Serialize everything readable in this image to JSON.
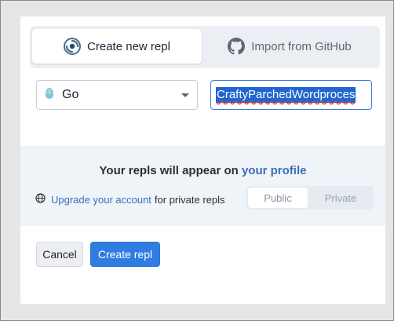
{
  "tabs": {
    "create_label": "Create new repl",
    "import_label": "Import from GitHub"
  },
  "form": {
    "language": "Go",
    "repl_name": "CraftyParchedWordproces"
  },
  "info": {
    "title_prefix": "Your repls will appear on",
    "profile_link": "your profile",
    "upgrade_link": "Upgrade your account",
    "upgrade_suffix": "for private repls",
    "toggle_public": "Public",
    "toggle_private": "Private"
  },
  "buttons": {
    "cancel": "Cancel",
    "create": "Create repl"
  },
  "colors": {
    "accent": "#2f7de1",
    "link": "#3a6eb8",
    "selection": "#1e66d0",
    "panel_bg": "#eff4f9"
  },
  "icons": {
    "create_tab": "replit-swirl-icon",
    "import_tab": "github-icon",
    "language": "go-gopher-icon",
    "globe": "globe-icon",
    "dropdown": "chevron-down-icon"
  }
}
